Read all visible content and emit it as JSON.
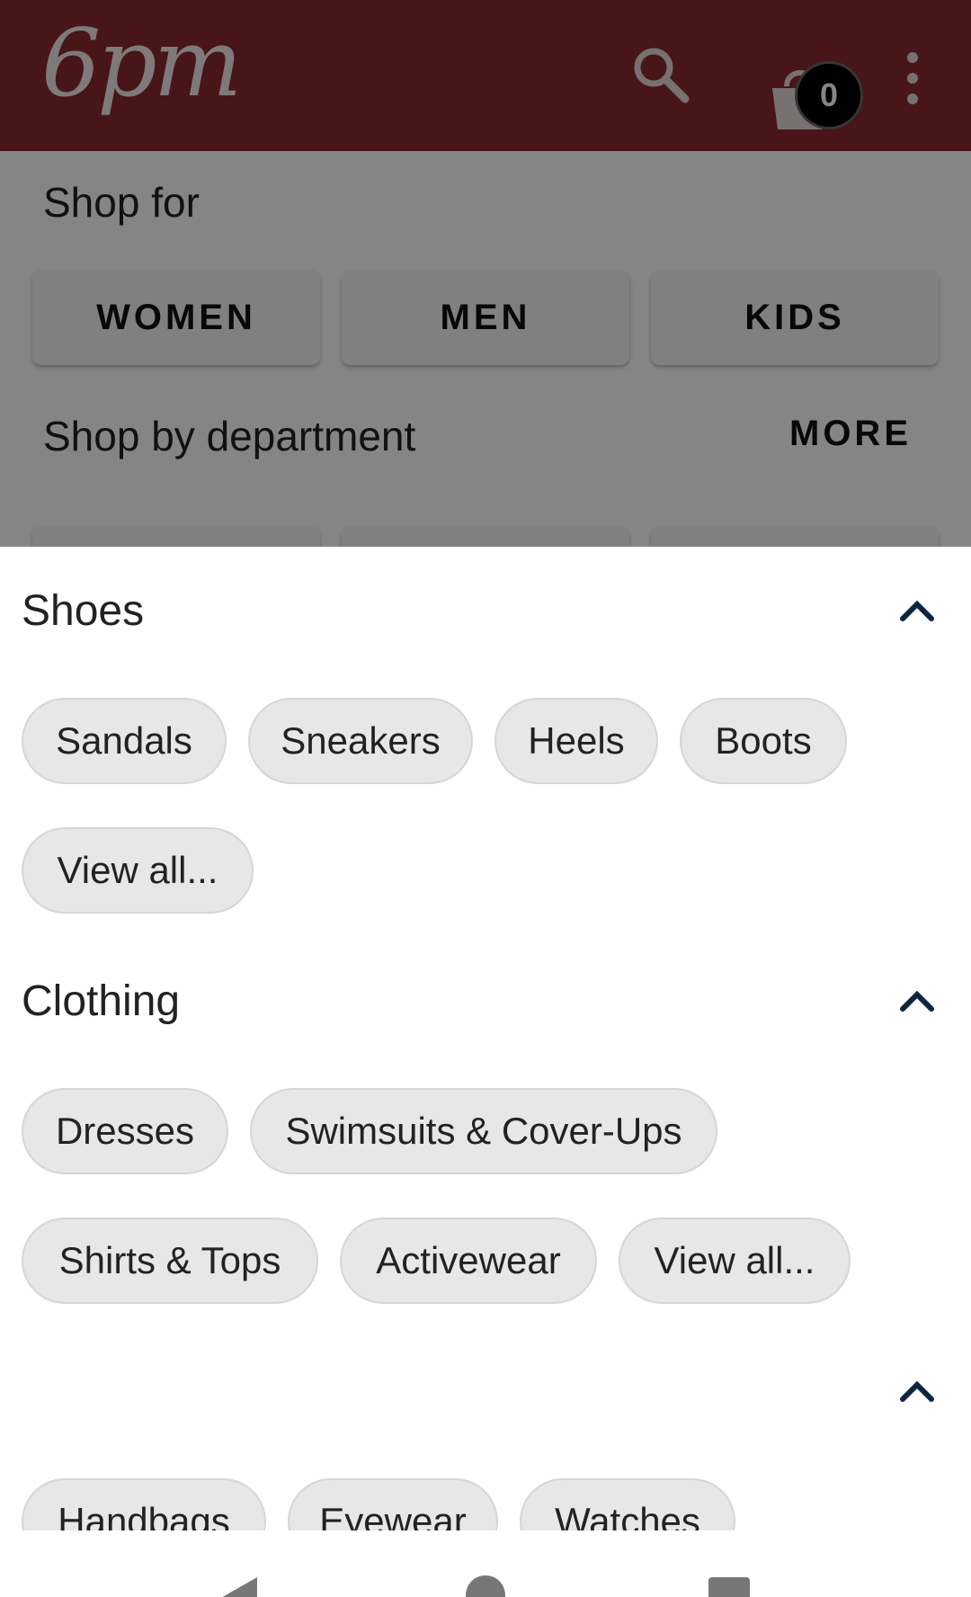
{
  "app_bar": {
    "logo": "6pm",
    "cart_count": "0",
    "colors": {
      "background": "#8a2a2f",
      "badge": "#000000"
    },
    "icons": [
      "search-icon",
      "shopping-bag-icon",
      "more-vert-icon"
    ]
  },
  "shop_for": {
    "title": "Shop for",
    "buttons": [
      "WOMEN",
      "MEN",
      "KIDS"
    ]
  },
  "department": {
    "title": "Shop by department",
    "more_label": "MORE"
  },
  "sheet": {
    "sections": [
      {
        "title": "Shoes",
        "chips": [
          "Sandals",
          "Sneakers",
          "Heels",
          "Boots",
          "View all..."
        ]
      },
      {
        "title": "Clothing",
        "chips": [
          "Dresses",
          "Swimsuits & Cover-Ups",
          "Shirts & Tops",
          "Activewear",
          "View all..."
        ]
      },
      {
        "title": "",
        "chips": [
          "Handbags",
          "Eyewear",
          "Watches"
        ]
      }
    ]
  },
  "nav": {
    "icons": [
      "back-icon",
      "home-icon",
      "recents-icon"
    ]
  }
}
